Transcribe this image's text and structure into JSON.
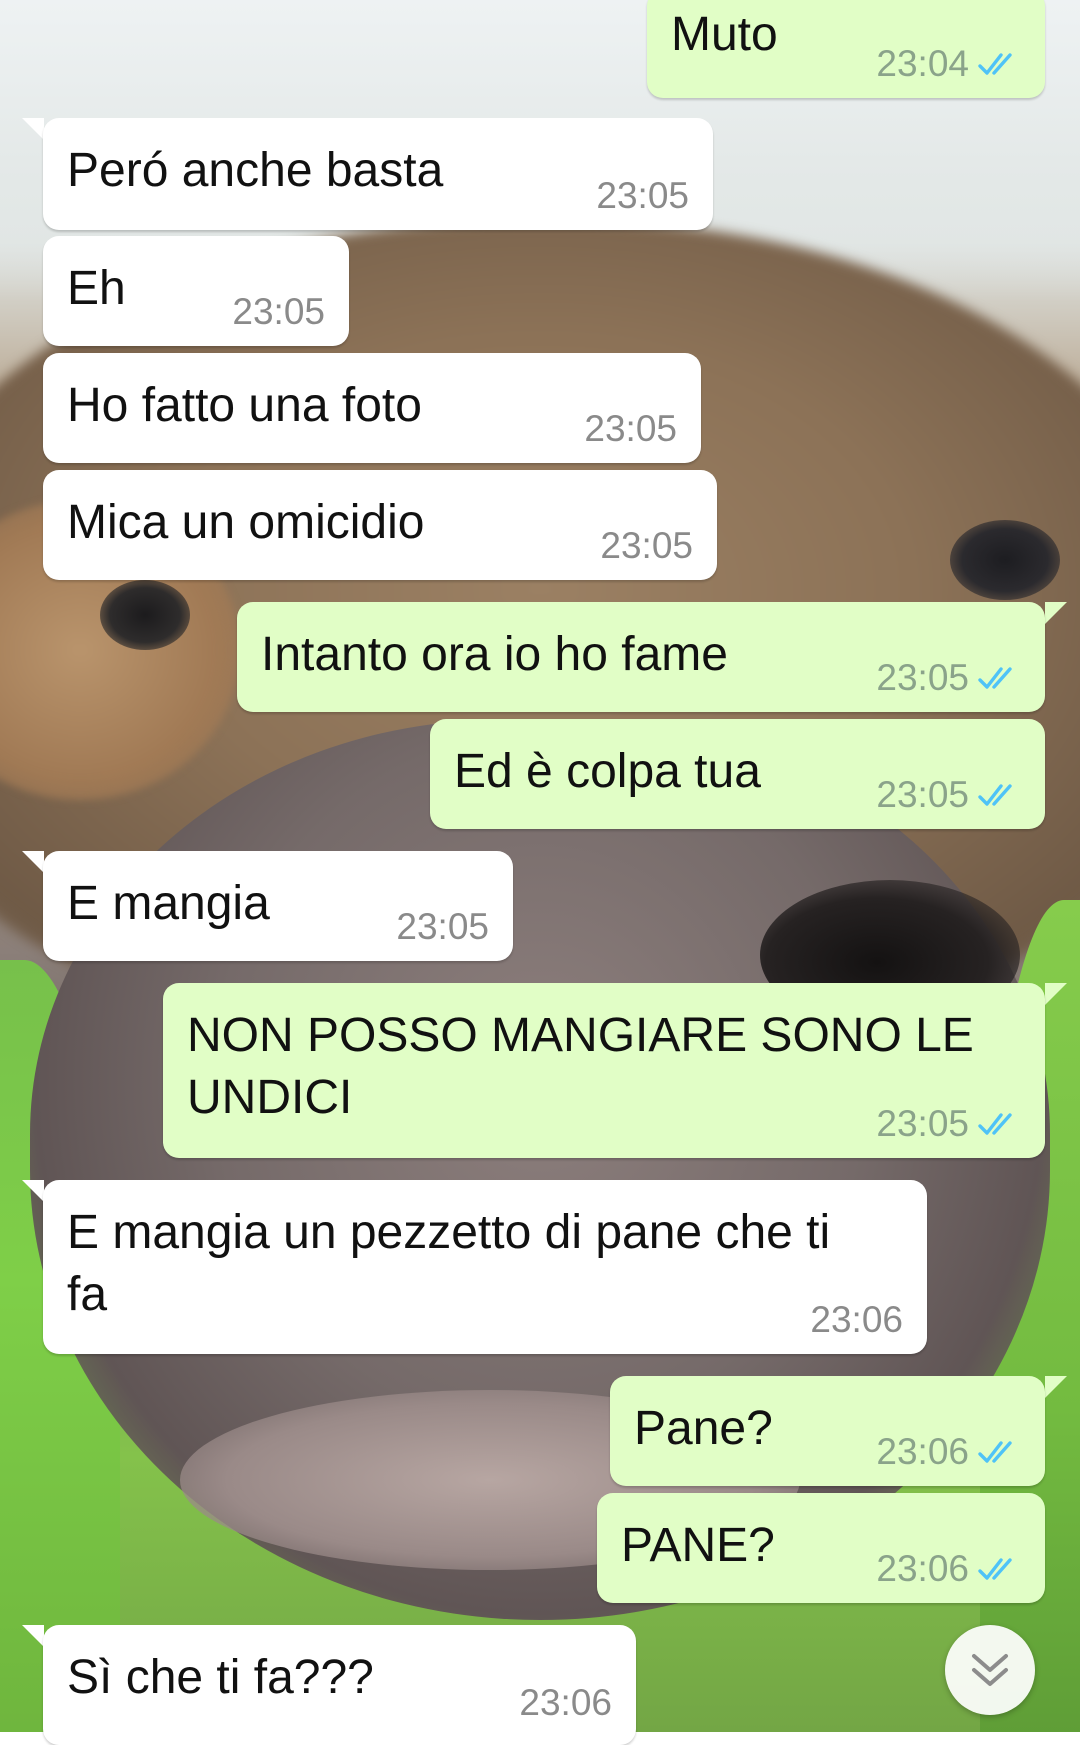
{
  "colors": {
    "incoming_bubble": "#ffffff",
    "outgoing_bubble": "#e1fec6",
    "timestamp_gray": "#8a8a8a",
    "read_tick_blue": "#4fc3f7"
  },
  "messages": [
    {
      "dir": "out",
      "text": "Muto",
      "time": "23:04",
      "status": "read"
    },
    {
      "dir": "in",
      "text": "Peró anche basta",
      "time": "23:05"
    },
    {
      "dir": "in",
      "text": "Eh",
      "time": "23:05"
    },
    {
      "dir": "in",
      "text": "Ho fatto una foto",
      "time": "23:05"
    },
    {
      "dir": "in",
      "text": "Mica un omicidio",
      "time": "23:05"
    },
    {
      "dir": "out",
      "text": "Intanto ora io ho fame",
      "time": "23:05",
      "status": "read"
    },
    {
      "dir": "out",
      "text": "Ed è colpa tua",
      "time": "23:05",
      "status": "read"
    },
    {
      "dir": "in",
      "text": "E mangia",
      "time": "23:05"
    },
    {
      "dir": "out",
      "text": "NON POSSO MANGIARE SONO LE UNDICI",
      "time": "23:05",
      "status": "read"
    },
    {
      "dir": "in",
      "text": "E mangia un pezzetto di pane che ti fa",
      "time": "23:06"
    },
    {
      "dir": "out",
      "text": "Pane?",
      "time": "23:06",
      "status": "read"
    },
    {
      "dir": "out",
      "text": "PANE?",
      "time": "23:06",
      "status": "read"
    },
    {
      "dir": "in",
      "text": "Sì che ti fa???",
      "time": "23:06"
    }
  ],
  "scroll_to_bottom": {
    "icon": "double-chevron-down-icon"
  }
}
